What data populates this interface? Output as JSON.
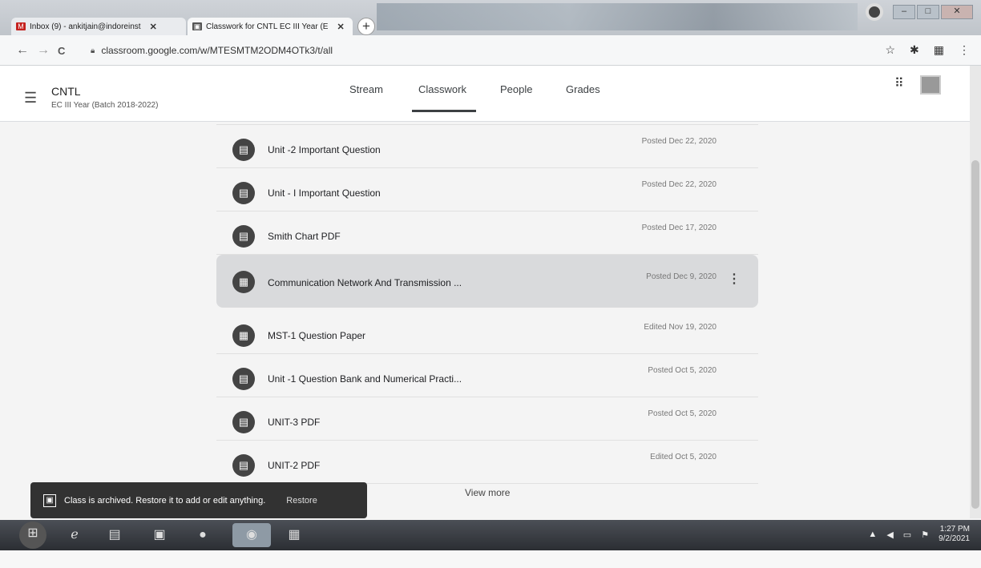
{
  "browser": {
    "tabs": [
      {
        "label": "Inbox (9) - ankitjain@indoreinst",
        "close": "✕"
      },
      {
        "label": "Classwork for CNTL EC III Year (E",
        "close": "✕"
      }
    ],
    "new_tab": "+",
    "url": "classroom.google.com/w/MTESMTM2ODM4OTk3/t/all",
    "nav": {
      "back": "←",
      "forward": "→",
      "reload": "C"
    }
  },
  "classroom": {
    "course_title": "CNTL",
    "course_subtitle": "EC III Year (Batch 2018-2022)",
    "tabs": [
      "Stream",
      "Classwork",
      "People",
      "Grades"
    ],
    "active_tab": "Classwork",
    "items": [
      {
        "title": "Unit -2 Important Question",
        "date": "Posted Dec 22, 2020"
      },
      {
        "title": "Unit - I Important Question",
        "date": "Posted Dec 22, 2020"
      },
      {
        "title": "Smith Chart PDF",
        "date": "Posted Dec 17, 2020"
      },
      {
        "title": "Communication Network And Transmission ...",
        "date": "Posted Dec 9, 2020"
      },
      {
        "title": "MST-1 Question Paper",
        "date": "Edited Nov 19, 2020"
      },
      {
        "title": "Unit -1 Question Bank and Numerical Practi...",
        "date": "Posted Oct 5, 2020"
      },
      {
        "title": "UNIT-3 PDF",
        "date": "Posted Oct 5, 2020"
      },
      {
        "title": "UNIT-2 PDF",
        "date": "Edited Oct 5, 2020"
      }
    ],
    "view_more": "View more",
    "snackbar": {
      "message": "Class is archived. Restore it to add or edit anything.",
      "action": "Restore"
    }
  },
  "taskbar": {
    "time": "1:27 PM",
    "date": "9/2/2021"
  },
  "colors": {
    "highlight_row": "#d9dadc",
    "snackbar": "#323232",
    "accent": "#3c4043"
  }
}
